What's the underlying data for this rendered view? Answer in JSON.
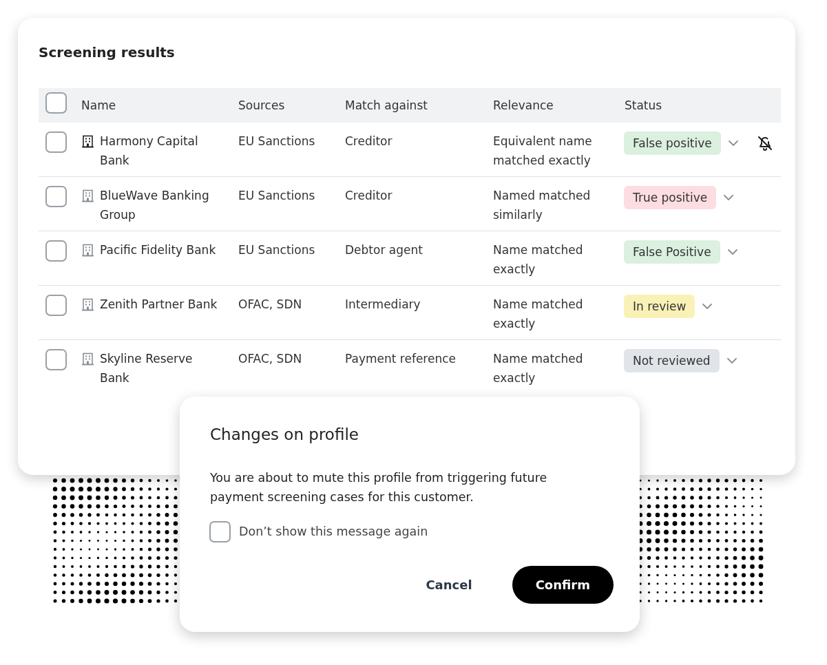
{
  "card": {
    "title": "Screening results"
  },
  "table": {
    "select_all": {
      "checked": false
    },
    "columns": [
      "Name",
      "Sources",
      "Match against",
      "Relevance",
      "Status"
    ],
    "rows": [
      {
        "checked": false,
        "name": "Harmony Capital Bank",
        "sources": "EU Sanctions",
        "match_against": "Creditor",
        "relevance": "Equivalent name matched exactly",
        "status": {
          "label": "False positive",
          "color": "#dbf0df"
        },
        "muted": true
      },
      {
        "checked": false,
        "name": "BlueWave Banking Group",
        "sources": "EU Sanctions",
        "match_against": "Creditor",
        "relevance": "Named matched similarly",
        "status": {
          "label": "True positive",
          "color": "#fcdde1"
        },
        "muted": false
      },
      {
        "checked": false,
        "name": "Pacific Fidelity Bank",
        "sources": "EU Sanctions",
        "match_against": "Debtor agent",
        "relevance": "Name matched exactly",
        "status": {
          "label": "False Positive",
          "color": "#dbf0df"
        },
        "muted": false
      },
      {
        "checked": false,
        "name": "Zenith Partner Bank",
        "sources": "OFAC, SDN",
        "match_against": "Intermediary",
        "relevance": "Name matched exactly",
        "status": {
          "label": "In review",
          "color": "#faf1b6"
        },
        "muted": false
      },
      {
        "checked": false,
        "name": "Skyline Reserve Bank",
        "sources": "OFAC, SDN",
        "match_against": "Payment reference",
        "relevance": "Name matched exactly",
        "status": {
          "label": "Not reviewed",
          "color": "#e1e4e8"
        },
        "muted": false
      }
    ]
  },
  "dialog": {
    "title": "Changes on profile",
    "message": "You are about to mute this profile from triggering future payment screening cases for this customer.",
    "dont_show_again": {
      "label": "Don’t show this message again",
      "checked": false
    },
    "cancel": "Cancel",
    "confirm": "Confirm"
  }
}
